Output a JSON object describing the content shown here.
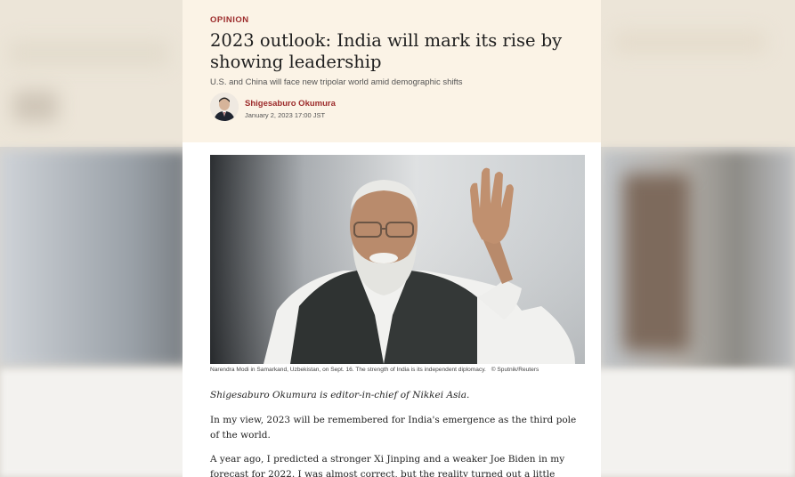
{
  "article": {
    "kicker": "OPINION",
    "headline": "2023 outlook: India will mark its rise by showing leadership",
    "subheadline": "U.S. and China will face new tripolar world amid demographic shifts",
    "author": {
      "name": "Shigesaburo Okumura",
      "date": "January 2, 2023 17:00 JST"
    },
    "image": {
      "caption": "Narendra Modi in Samarkand, Uzbekistan, on Sept. 16. The strength of India is its independent diplomacy.",
      "credit": "© Sputnik/Reuters"
    },
    "paragraphs": [
      "Shigesaburo Okumura is editor-in-chief of Nikkei Asia.",
      "In my view, 2023 will be remembered for India's emergence as the third pole of the world.",
      "A year ago, I predicted a stronger Xi Jinping and a weaker Joe Biden in my forecast for 2022. I was almost correct, but the reality turned out a little differently than I expected"
    ]
  },
  "colors": {
    "accent": "#9c2b2b",
    "header_background": "#fbf3e6",
    "text": "#1f1f1f"
  }
}
